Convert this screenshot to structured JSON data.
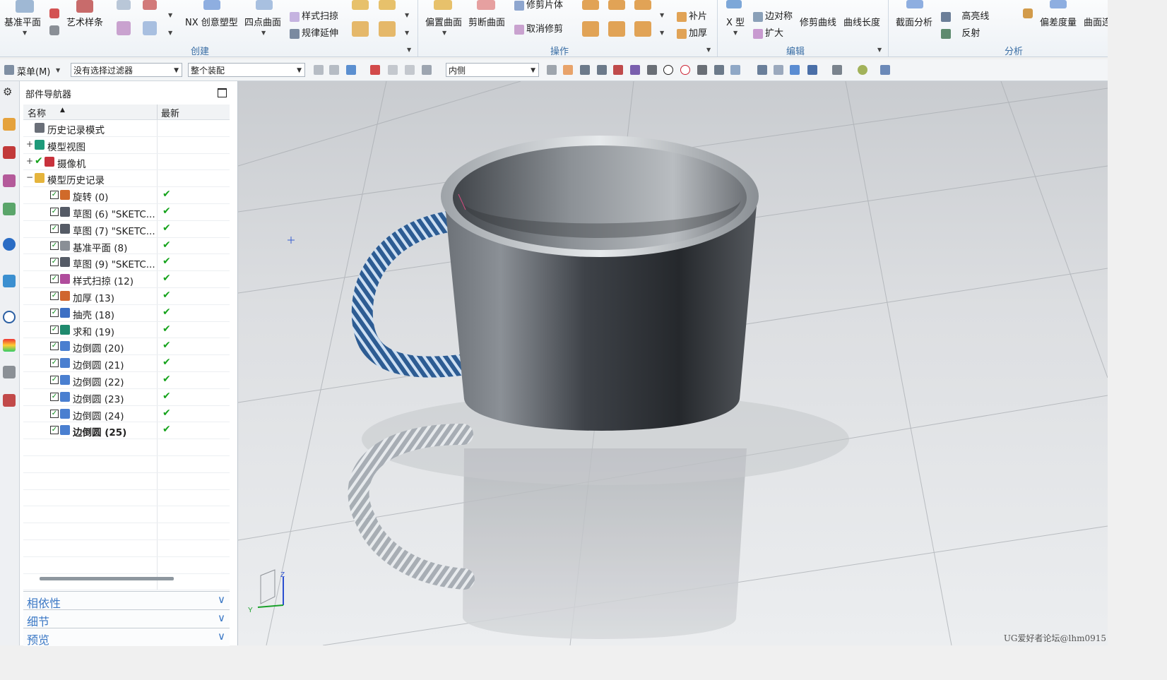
{
  "ribbon": {
    "items": {
      "datum_plane": "基准平面",
      "art_spline": "艺术样条",
      "nx_creative": "NX 创意塑型",
      "four_point_surface": "四点曲面",
      "styled_sweep": "样式扫掠",
      "law_extension": "规律延伸",
      "offset_surface": "偏置曲面",
      "trim_surface": "剪断曲面",
      "trim_sheet": "修剪片体",
      "untrim": "取消修剪",
      "patch": "补片",
      "thicken": "加厚",
      "x_form": "X 型",
      "edge_symmetry": "边对称",
      "enlarge": "扩大",
      "trim_curve": "修剪曲线",
      "curve_length": "曲线长度",
      "section_analysis": "截面分析",
      "highlight_lines": "高亮线",
      "reflection": "反射",
      "deviation_gauge": "偏差度量",
      "surface_cont": "曲面连"
    },
    "groups": {
      "create": "创建",
      "operation": "操作",
      "edit": "编辑",
      "analysis": "分析"
    }
  },
  "toolbar": {
    "menu": "菜单(M)",
    "filter": "没有选择过滤器",
    "assembly": "整个装配",
    "inside": "内侧"
  },
  "navigator": {
    "title": "部件导航器",
    "col_name": "名称",
    "col_latest": "最新",
    "rows": [
      {
        "label": "历史记录模式",
        "level": 0,
        "expand": "",
        "checkbox": false,
        "latest": false,
        "icon_color": "#6a6f78"
      },
      {
        "label": "模型视图",
        "level": 0,
        "expand": "+",
        "checkbox": false,
        "latest": false,
        "icon_color": "#1e9a7a"
      },
      {
        "label": "摄像机",
        "level": 0,
        "expand": "+",
        "checkbox": false,
        "latest": false,
        "icon_color": "#c8323c",
        "green_before": true
      },
      {
        "label": "模型历史记录",
        "level": 0,
        "expand": "−",
        "checkbox": false,
        "latest": false,
        "icon_color": "#e5b43c"
      },
      {
        "label": "旋转 (0)",
        "level": 1,
        "checkbox": true,
        "latest": true,
        "icon_color": "#d06a2a"
      },
      {
        "label": "草图 (6) \"SKETC...",
        "level": 1,
        "checkbox": true,
        "latest": true,
        "icon_color": "#555b66"
      },
      {
        "label": "草图 (7) \"SKETC...",
        "level": 1,
        "checkbox": true,
        "latest": true,
        "icon_color": "#555b66"
      },
      {
        "label": "基准平面 (8)",
        "level": 1,
        "checkbox": true,
        "latest": true,
        "icon_color": "#8a8f96"
      },
      {
        "label": "草图 (9) \"SKETC...",
        "level": 1,
        "checkbox": true,
        "latest": true,
        "icon_color": "#555b66"
      },
      {
        "label": "样式扫掠 (12)",
        "level": 1,
        "checkbox": true,
        "latest": true,
        "icon_color": "#b04c9c"
      },
      {
        "label": "加厚 (13)",
        "level": 1,
        "checkbox": true,
        "latest": true,
        "icon_color": "#d0662f"
      },
      {
        "label": "抽壳 (18)",
        "level": 1,
        "checkbox": true,
        "latest": true,
        "icon_color": "#3c6fc4"
      },
      {
        "label": "求和 (19)",
        "level": 1,
        "checkbox": true,
        "latest": true,
        "icon_color": "#1f8a6e"
      },
      {
        "label": "边倒圆 (20)",
        "level": 1,
        "checkbox": true,
        "latest": true,
        "icon_color": "#4a7fd0"
      },
      {
        "label": "边倒圆 (21)",
        "level": 1,
        "checkbox": true,
        "latest": true,
        "icon_color": "#4a7fd0"
      },
      {
        "label": "边倒圆 (22)",
        "level": 1,
        "checkbox": true,
        "latest": true,
        "icon_color": "#4a7fd0"
      },
      {
        "label": "边倒圆 (23)",
        "level": 1,
        "checkbox": true,
        "latest": true,
        "icon_color": "#4a7fd0"
      },
      {
        "label": "边倒圆 (24)",
        "level": 1,
        "checkbox": true,
        "latest": true,
        "icon_color": "#4a7fd0"
      },
      {
        "label": "边倒圆 (25)",
        "level": 1,
        "checkbox": true,
        "latest": true,
        "icon_color": "#4a7fd0",
        "bold": true
      }
    ],
    "sections": [
      "相依性",
      "细节",
      "预览"
    ]
  },
  "viewport": {
    "axis_z": "Z",
    "axis_y": "Y",
    "watermark": "UG爱好者论坛@lhm0915"
  }
}
